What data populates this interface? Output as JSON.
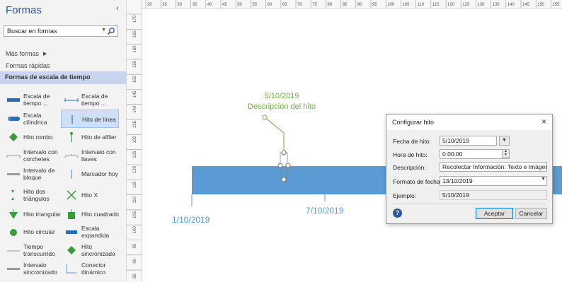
{
  "panel": {
    "title": "Formas",
    "collapse_icon": "chevron-left",
    "search": {
      "value": "Buscar en formas",
      "icon": "search-icon"
    },
    "more_shapes": "Más formas",
    "quick_shapes": "Formas rápidas",
    "section_title": "Formas de escala de tiempo",
    "shapes": [
      {
        "label": "Escala de tiempo ...",
        "icon": "block-timeline-icon"
      },
      {
        "label": "Escala de tiempo ...",
        "icon": "line-timeline-icon"
      },
      {
        "label": "Escala cilíndrica",
        "icon": "cylinder-timeline-icon"
      },
      {
        "label": "Hito de línea",
        "icon": "line-milestone-icon"
      },
      {
        "label": "Hito rombo",
        "icon": "diamond-milestone-icon"
      },
      {
        "label": "Hito de alfiler",
        "icon": "pin-milestone-icon"
      },
      {
        "label": "Intervalo con corchetes",
        "icon": "bracket-interval-icon"
      },
      {
        "label": "Intervalo con llaves",
        "icon": "brace-interval-icon"
      },
      {
        "label": "Intervalo de bloque",
        "icon": "block-interval-icon"
      },
      {
        "label": "Marcador hoy",
        "icon": "today-marker-icon"
      },
      {
        "label": "Hito dos triángulos",
        "icon": "two-triangle-milestone-icon"
      },
      {
        "label": "Hito X",
        "icon": "x-milestone-icon"
      },
      {
        "label": "Hito triangular",
        "icon": "triangle-milestone-icon"
      },
      {
        "label": "Hito cuadrado",
        "icon": "square-milestone-icon"
      },
      {
        "label": "Hito circular",
        "icon": "circle-milestone-icon"
      },
      {
        "label": "Escala expandida",
        "icon": "expanded-timeline-icon"
      },
      {
        "label": "Tiempo transcurrido",
        "icon": "elapsed-time-icon"
      },
      {
        "label": "Hito sincronizado",
        "icon": "synced-milestone-icon"
      },
      {
        "label": "Intervalo sincronizado",
        "icon": "synced-interval-icon"
      },
      {
        "label": "Conector dinámico",
        "icon": "dynamic-connector-icon"
      }
    ]
  },
  "rulers": {
    "horizontal": [
      "20",
      "25",
      "30",
      "35",
      "40",
      "45",
      "50",
      "55",
      "60",
      "65",
      "70",
      "75",
      "80",
      "85",
      "90",
      "95",
      "100",
      "105",
      "110",
      "115",
      "120",
      "125",
      "130",
      "135",
      "140",
      "145",
      "150",
      "155"
    ],
    "vertical": [
      "170",
      "165",
      "160",
      "155",
      "150",
      "145",
      "140",
      "135",
      "130",
      "125",
      "120",
      "115",
      "110",
      "105",
      "100",
      "95",
      "90",
      "85"
    ]
  },
  "canvas": {
    "timeline_start": "1/10/2019",
    "timeline_mid": "7/10/2019",
    "milestone_date": "5/10/2019",
    "milestone_desc": "Descripción del hito",
    "colors": {
      "timeline": "#5b9bd5",
      "milestone": "#70ad47"
    }
  },
  "dialog": {
    "title": "Configurar hito",
    "close": "×",
    "fields": {
      "date_label": "Fecha de hito:",
      "date_value": "5/10/2019",
      "time_label": "Hora de hito:",
      "time_value": "0:00:00",
      "desc_label": "Descripción:",
      "desc_value": "Recolectar Información: Texto e Imágenes",
      "format_label": "Formato de fecha:",
      "format_value": "13/10/2019",
      "example_label": "Ejemplo:",
      "example_value": "5/10/2019"
    },
    "ok": "Aceptar",
    "cancel": "Cancelar"
  }
}
